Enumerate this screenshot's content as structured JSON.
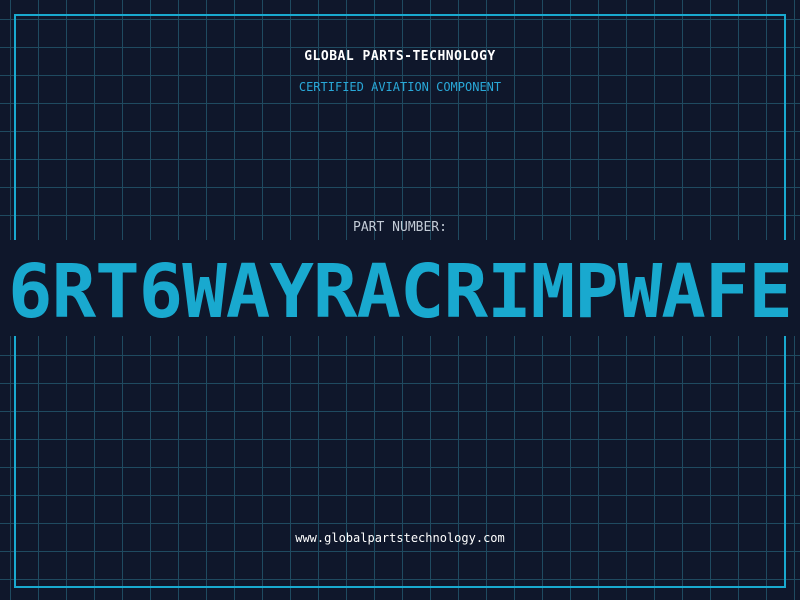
{
  "header": {
    "company": "GLOBAL PARTS-TECHNOLOGY",
    "subtitle": "CERTIFIED AVIATION COMPONENT"
  },
  "part": {
    "label": "PART NUMBER:",
    "value": "6RT6WAYRACRIMPWAFE"
  },
  "footer": {
    "website": "www.globalpartstechnology.com"
  },
  "colors": {
    "background": "#0f172b",
    "grid": "#1f4a60",
    "accent": "#19a9cf",
    "text": "#ffffff",
    "label": "#c3cbd6"
  }
}
